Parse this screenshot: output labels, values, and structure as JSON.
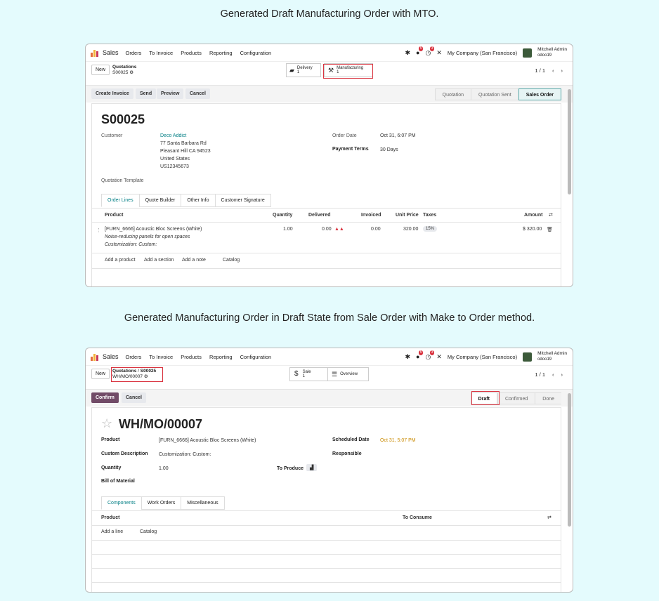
{
  "captions": {
    "first": "Generated Draft Manufacturing Order with MTO.",
    "second": "Generated Manufacturing Order in Draft State from Sale Order with Make to Order method."
  },
  "nav": {
    "app_name": "Sales",
    "menu": [
      "Orders",
      "To Invoice",
      "Products",
      "Reporting",
      "Configuration"
    ],
    "messages_badge": "5",
    "activities_badge": "3",
    "company": "My Company (San Francisco)",
    "user_name": "Mitchell Admin",
    "db_name": "odoo19"
  },
  "sale_order": {
    "new_label": "New",
    "breadcrumb_parent": "Quotations",
    "record_ref": "S00025",
    "smart_delivery": {
      "label": "Delivery",
      "count": "1"
    },
    "smart_manufacturing": {
      "label": "Manufacturing",
      "count": "1"
    },
    "pager": "1 / 1",
    "actions": [
      "Create Invoice",
      "Send",
      "Preview",
      "Cancel"
    ],
    "statuses": [
      "Quotation",
      "Quotation Sent",
      "Sales Order"
    ],
    "title": "S00025",
    "customer_label": "Customer",
    "customer_name": "Deco Addict",
    "address": [
      "77 Santa Barbara Rd",
      "Pleasant Hill CA 94523",
      "United States",
      "US12345673"
    ],
    "order_date_label": "Order Date",
    "order_date": "Oct 31, 6:07 PM",
    "payment_terms_label": "Payment Terms",
    "payment_terms": "30 Days",
    "quotation_template_label": "Quotation Template",
    "tabs": [
      "Order Lines",
      "Quote Builder",
      "Other Info",
      "Customer Signature"
    ],
    "columns": {
      "product": "Product",
      "quantity": "Quantity",
      "delivered": "Delivered",
      "invoiced": "Invoiced",
      "unit_price": "Unit Price",
      "taxes": "Taxes",
      "amount": "Amount"
    },
    "line": {
      "product": "[FURN_6666] Acoustic Bloc Screens (White)",
      "desc1": "Noise-reducing panels for open spaces",
      "desc2": "Customization: Custom:",
      "quantity": "1.00",
      "delivered": "0.00",
      "invoiced": "0.00",
      "unit_price": "320.00",
      "tax": "15%",
      "amount": "$ 320.00"
    },
    "add_links": [
      "Add a product",
      "Add a section",
      "Add a note",
      "Catalog"
    ]
  },
  "mo": {
    "new_label": "New",
    "breadcrumb_parent": "Quotations",
    "breadcrumb_sep": "/",
    "breadcrumb_so": "S00025",
    "record_ref": "WH/MO/00007",
    "smart_sale": {
      "label": "Sale",
      "count": "1"
    },
    "smart_overview": "Overview",
    "pager": "1 / 1",
    "confirm_label": "Confirm",
    "cancel_label": "Cancel",
    "statuses": [
      "Draft",
      "Confirmed",
      "Done"
    ],
    "title": "WH/MO/00007",
    "product_label": "Product",
    "product_value": "[FURN_6666] Acoustic Bloc Screens (White)",
    "custom_desc_label": "Custom Description",
    "custom_desc_value": "Customization: Custom:",
    "quantity_label": "Quantity",
    "quantity_value": "1.00",
    "to_produce_label": "To Produce",
    "bom_label": "Bill of Material",
    "scheduled_label": "Scheduled Date",
    "scheduled_value": "Oct 31, 5:07 PM",
    "responsible_label": "Responsible",
    "tabs": [
      "Components",
      "Work Orders",
      "Miscellaneous"
    ],
    "col_product": "Product",
    "col_consume": "To Consume",
    "add_line": "Add a line",
    "catalog": "Catalog"
  },
  "colors": {
    "primary": "#714b67",
    "link": "#017e84",
    "highlight": "#d9333f"
  }
}
